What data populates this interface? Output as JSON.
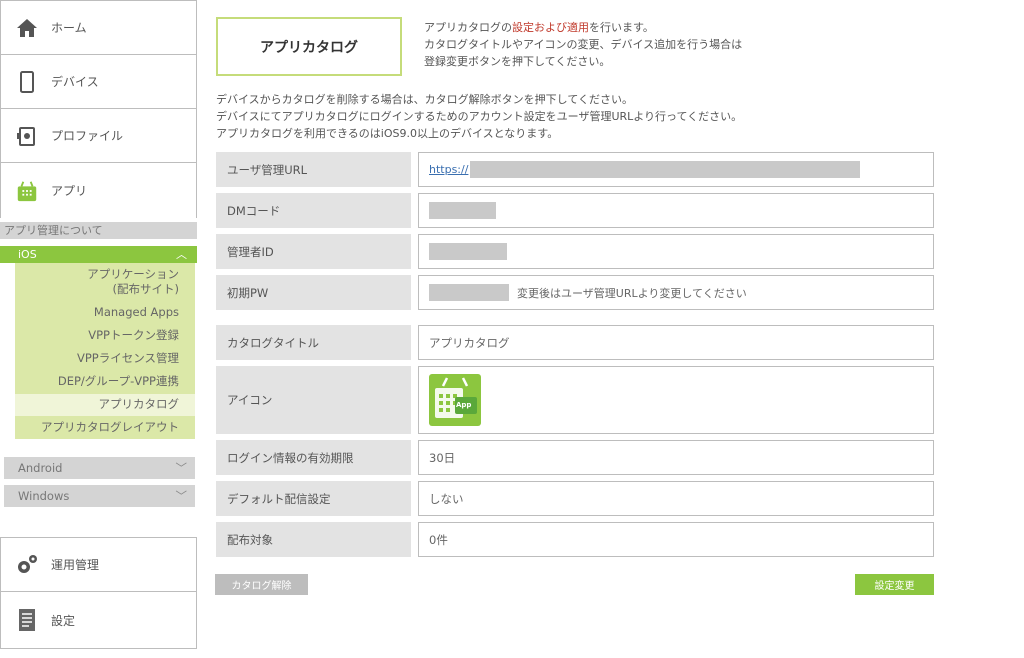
{
  "sidebar": {
    "main_items": [
      {
        "label": "ホーム",
        "icon": "home-icon"
      },
      {
        "label": "デバイス",
        "icon": "device-icon"
      },
      {
        "label": "プロファイル",
        "icon": "profile-icon"
      },
      {
        "label": "アプリ",
        "icon": "app-icon"
      },
      {
        "label": "運用管理",
        "icon": "gear-icon"
      },
      {
        "label": "設定",
        "icon": "settings-document-icon"
      }
    ],
    "about_app_mgmt": "アプリ管理について",
    "ios_label": "iOS",
    "ios_items": [
      {
        "label_line1": "アプリケーション",
        "label_line2": "(配布サイト)"
      },
      {
        "label": "Managed Apps"
      },
      {
        "label": "VPPトークン登録"
      },
      {
        "label": "VPPライセンス管理"
      },
      {
        "label": "DEP/グループ-VPP連携"
      },
      {
        "label": "アプリカタログ"
      },
      {
        "label": "アプリカタログレイアウト"
      }
    ],
    "android_label": "Android",
    "windows_label": "Windows"
  },
  "main": {
    "title": "アプリカタログ",
    "intro_line1_pre": "アプリカタログの",
    "intro_line1_red": "設定および適用",
    "intro_line1_post": "を行います。",
    "intro_line2": "カタログタイトルやアイコンの変更、デバイス追加を行う場合は",
    "intro_line3": "登録変更ボタンを押下してください。",
    "note_line1": "デバイスからカタログを削除する場合は、カタログ解除ボタンを押下してください。",
    "note_line2": "デバイスにてアプリカタログにログインするためのアカウント設定をユーザ管理URLより行ってください。",
    "note_line3": "アプリカタログを利用できるのはiOS9.0以上のデバイスとなります。",
    "form": {
      "user_url_label": "ユーザ管理URL",
      "user_url_value": "https://",
      "dm_code_label": "DMコード",
      "admin_id_label": "管理者ID",
      "initial_pw_label": "初期PW",
      "initial_pw_note": "変更後はユーザ管理URLより変更してください",
      "catalog_title_label": "カタログタイトル",
      "catalog_title_value": "アプリカタログ",
      "icon_label": "アイコン",
      "icon_app_text": "App",
      "login_expiry_label": "ログイン情報の有効期限",
      "login_expiry_value": "30日",
      "default_dist_label": "デフォルト配信設定",
      "default_dist_value": "しない",
      "dist_target_label": "配布対象",
      "dist_target_value": "0件"
    },
    "release_button": "カタログ解除",
    "change_button": "設定変更"
  },
  "colors": {
    "accent_green": "#8cc63f",
    "light_green": "#dbe8a8",
    "label_bg": "#e3e3e3"
  }
}
